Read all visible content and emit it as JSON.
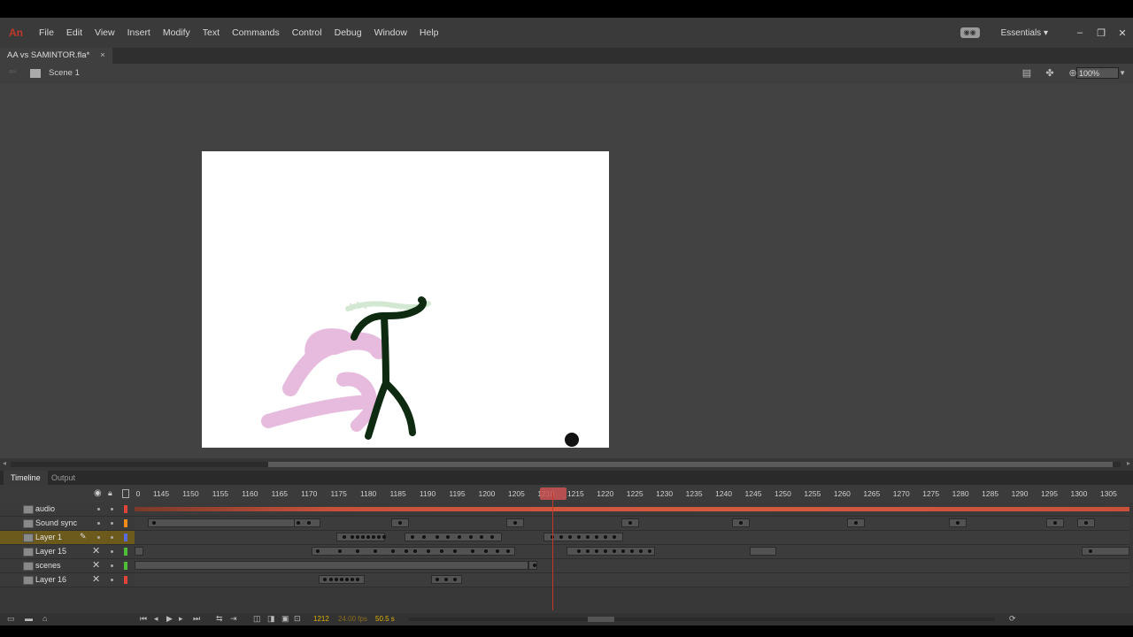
{
  "app": {
    "logo": "An"
  },
  "menu": [
    "File",
    "Edit",
    "View",
    "Insert",
    "Modify",
    "Text",
    "Commands",
    "Control",
    "Debug",
    "Window",
    "Help"
  ],
  "workspace": "Essentials",
  "window_buttons": [
    "–",
    "❐",
    "✕"
  ],
  "document": {
    "tab": "AA vs SAMINTOR.fla*",
    "close": "×"
  },
  "editbar": {
    "scene": "Scene 1",
    "zoom": "100%"
  },
  "panel_tabs": {
    "timeline": "Timeline",
    "output": "Output"
  },
  "ruler": {
    "ticks": [
      "0",
      "1145",
      "1150",
      "1155",
      "1160",
      "1165",
      "1170",
      "1175",
      "1180",
      "1185",
      "1190",
      "1195",
      "1200",
      "1205",
      "1210",
      "1215",
      "1220",
      "1225",
      "1230",
      "1235",
      "1240",
      "1245",
      "1250",
      "1255",
      "1260",
      "1265",
      "1270",
      "1275",
      "1280",
      "1285",
      "1290",
      "1295",
      "1300",
      "1305"
    ],
    "current_frame_label": "1212"
  },
  "layers": [
    {
      "name": "audio",
      "color": "#e0453a",
      "hidden": false,
      "selected": false
    },
    {
      "name": "Sound sync",
      "color": "#f08a1a",
      "hidden": false,
      "selected": false
    },
    {
      "name": "Layer 1",
      "color": "#5a6ad8",
      "hidden": false,
      "selected": true
    },
    {
      "name": "Layer 15",
      "color": "#4fbf3a",
      "hidden": true,
      "selected": false
    },
    {
      "name": "scenes",
      "color": "#4fbf3a",
      "hidden": true,
      "selected": false
    },
    {
      "name": "Layer 16",
      "color": "#e0453a",
      "hidden": true,
      "selected": false
    }
  ],
  "status": {
    "frame": "1212",
    "fps": "24.00 fps",
    "time": "50.5 s"
  },
  "colors": {
    "stage": "#ffffff",
    "panel": "#424242",
    "playhead": "#c0392b",
    "figure_dark": "#0e2a10",
    "figure_pink": "#e6b8dd"
  }
}
